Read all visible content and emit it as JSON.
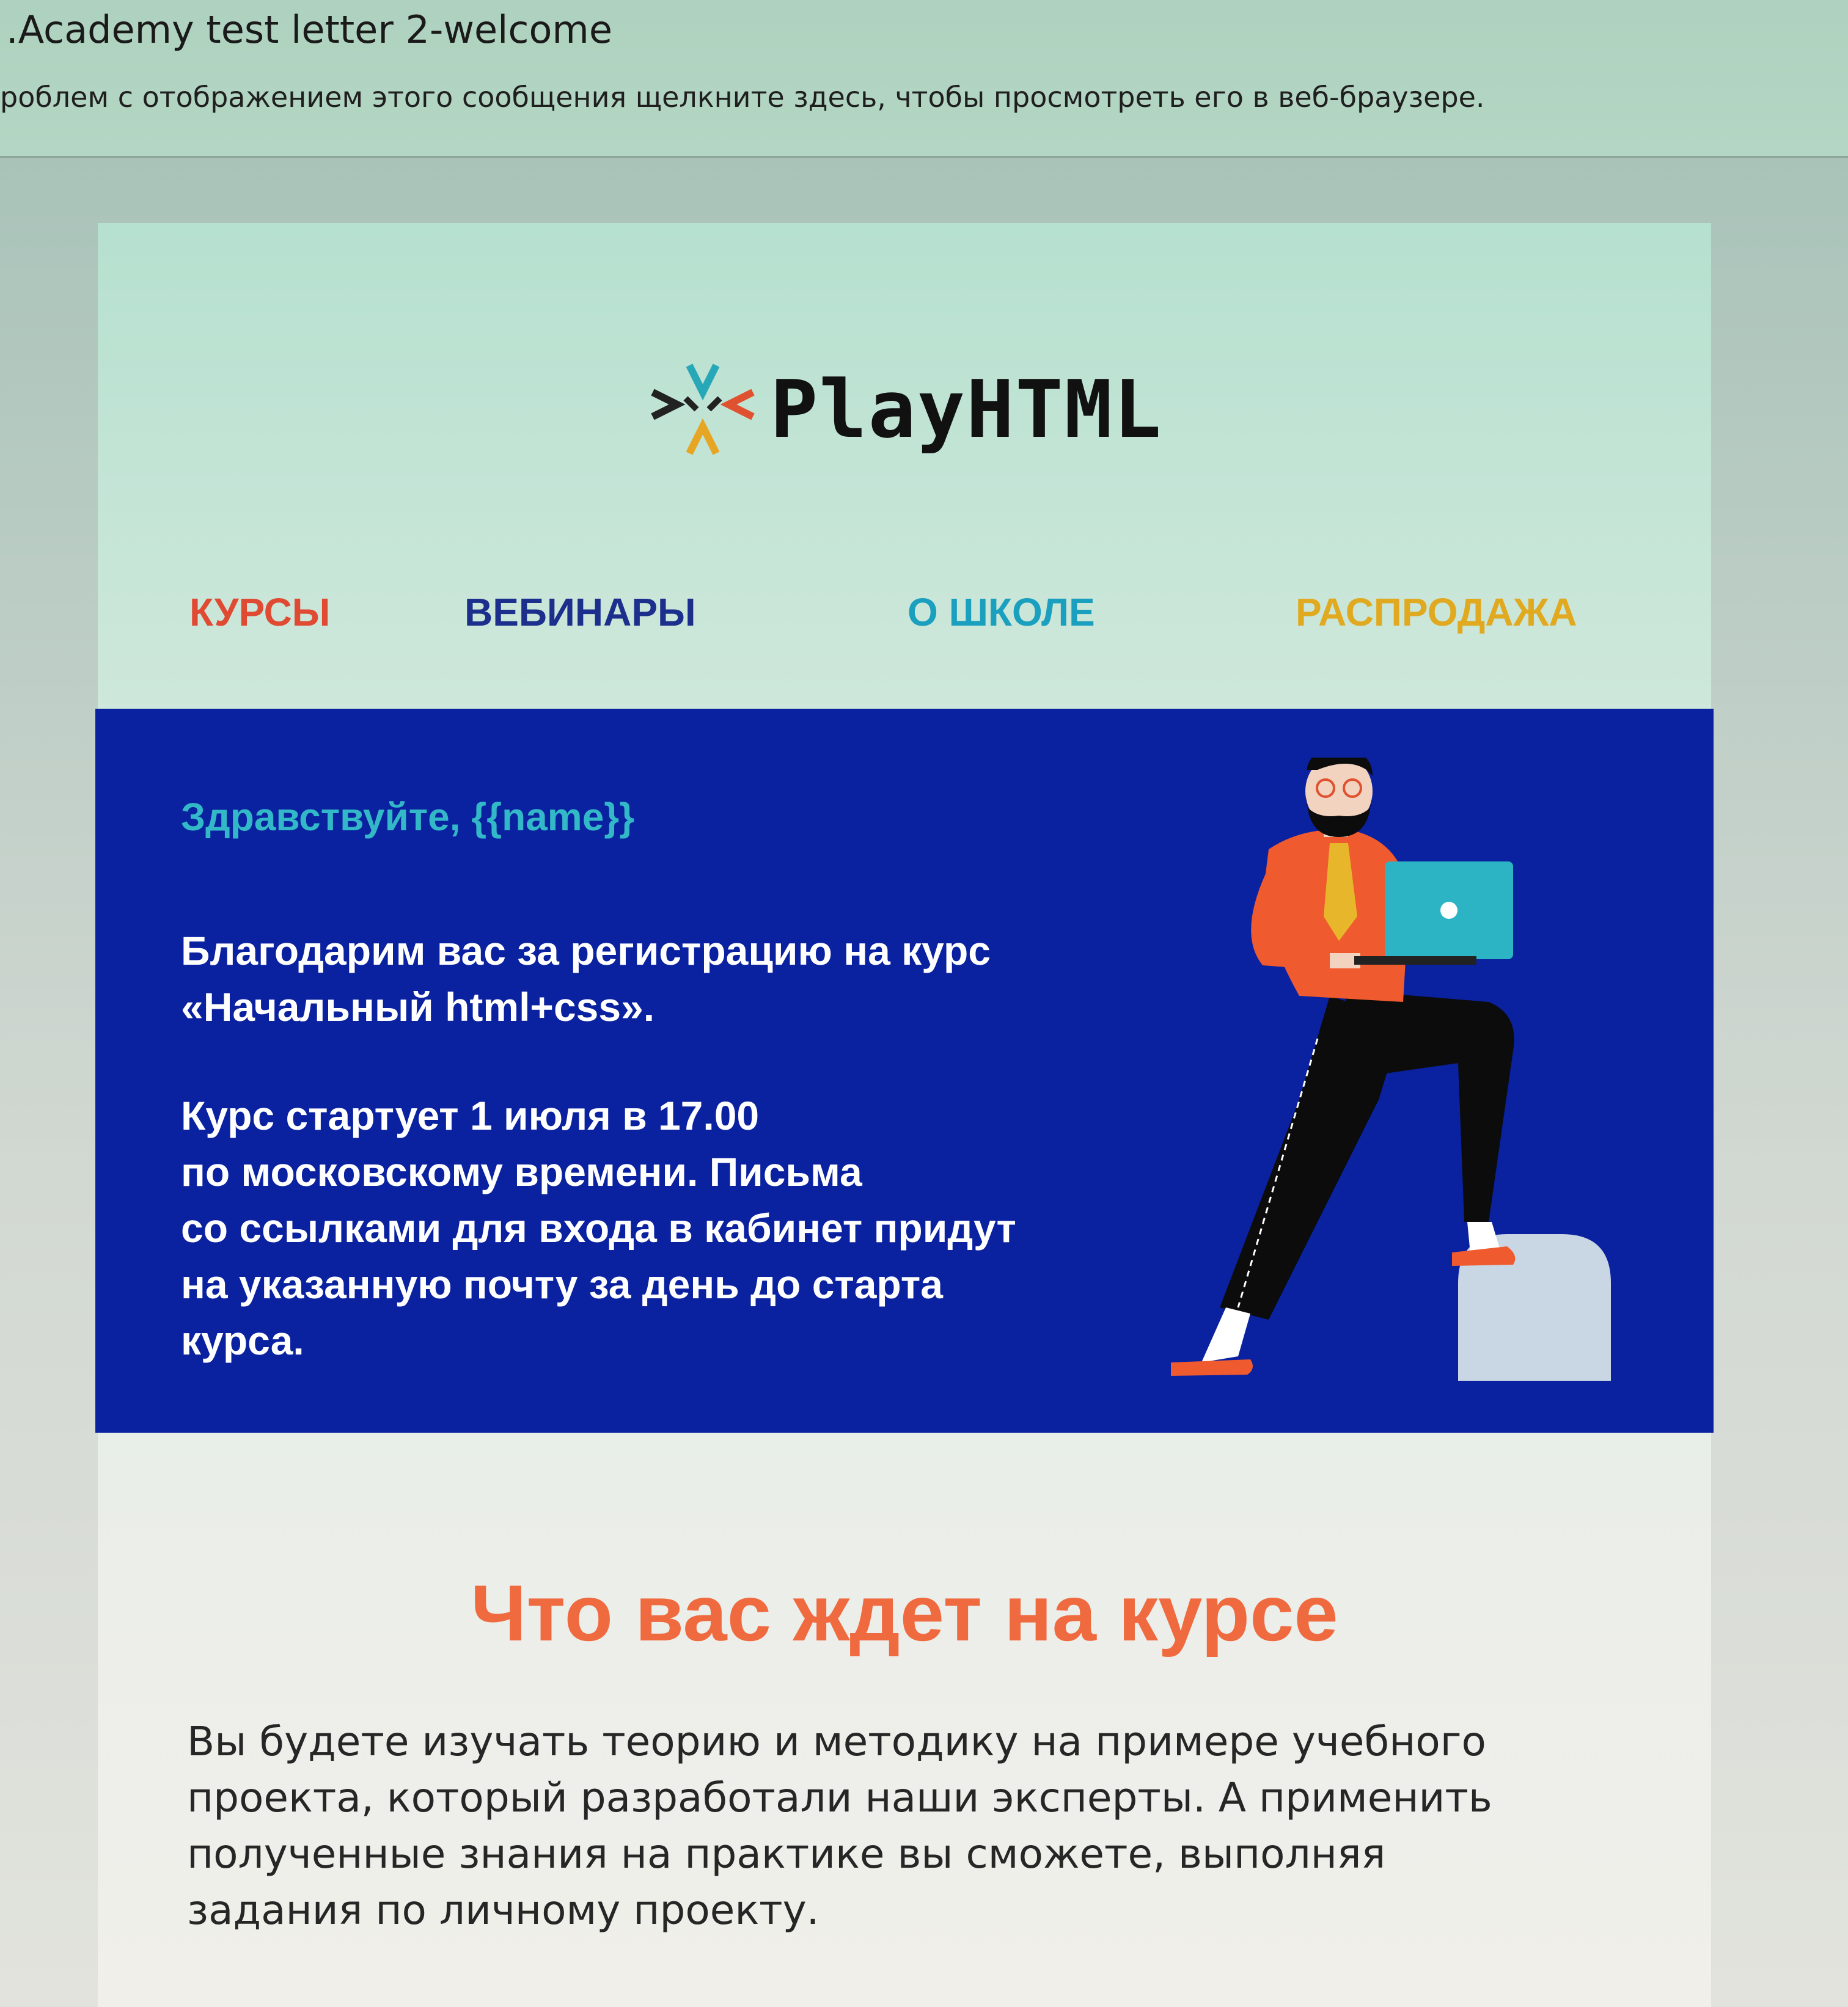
{
  "window": {
    "subject": ".Academy test letter 2-welcome",
    "notice": "роблем с отображением этого сообщения щелкните здесь, чтобы просмотреть его в веб-браузере."
  },
  "email": {
    "logo": {
      "text": "PlayHTML",
      "icon": "playhtml-logo-icon"
    },
    "nav": [
      {
        "label": "КУРСЫ",
        "color": "#e04a33"
      },
      {
        "label": "ВЕБИНАРЫ",
        "color": "#1c2f8c"
      },
      {
        "label": "О ШКОЛЕ",
        "color": "#1a9fbf"
      },
      {
        "label": "РАСПРОДАЖА",
        "color": "#e1a91f"
      }
    ],
    "banner": {
      "greeting": "Здравствуйте, {{name}}",
      "thanks_lines": [
        "Благодарим вас за регистрацию на курс",
        "«Начальный html+css»."
      ],
      "start_lines": [
        "Курс стартует 1 июля в 17.00",
        "по московскому времени. Письма",
        "со ссылками для входа в кабинет придут",
        "на указанную почту за день до старта",
        "курса."
      ],
      "illustration": "man-with-laptop-illustration",
      "background": "#0a21a0"
    },
    "section": {
      "title": "Что вас ждет на курсе",
      "text_lines": [
        "Вы будете изучать теорию и методику на примере учебного",
        "проекта, который разработали наши эксперты. А применить",
        "полученные знания на практике вы сможете, выполняя",
        "задания по личному проекту."
      ]
    }
  }
}
